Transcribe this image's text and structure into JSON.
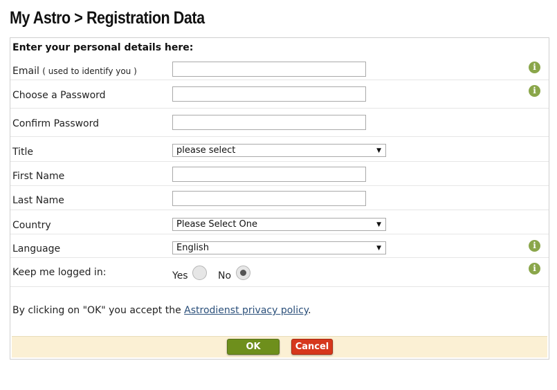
{
  "page": {
    "title": "My Astro > Registration Data"
  },
  "form": {
    "section_title": "Enter your personal details here:",
    "email": {
      "label": "Email",
      "note": "( used to identify you )",
      "value": ""
    },
    "password": {
      "label": "Choose a Password",
      "value": ""
    },
    "confirm_password": {
      "label": "Confirm Password",
      "value": ""
    },
    "title": {
      "label": "Title",
      "selected": "please select"
    },
    "first_name": {
      "label": "First Name",
      "value": ""
    },
    "last_name": {
      "label": "Last Name",
      "value": ""
    },
    "country": {
      "label": "Country",
      "selected": "Please Select One"
    },
    "language": {
      "label": "Language",
      "selected": "English"
    },
    "keep_logged_in": {
      "label": "Keep me logged in:",
      "yes_label": "Yes",
      "no_label": "No",
      "selected": "No"
    },
    "privacy": {
      "text_before": "By clicking on \"OK\" you accept the ",
      "link_text": "Astrodienst privacy policy",
      "text_after": "."
    },
    "info_icon_glyph": "i"
  },
  "buttons": {
    "ok_label": "OK",
    "cancel_label": "Cancel"
  },
  "colors": {
    "info_icon": "#8aa64a",
    "ok_button": "#6e8f1c",
    "cancel_button": "#d6371c",
    "button_bar": "#fbf0d4",
    "link": "#2a4f7a"
  },
  "icons": {
    "info": "info-icon",
    "select_arrow": "chevron-down-icon"
  }
}
